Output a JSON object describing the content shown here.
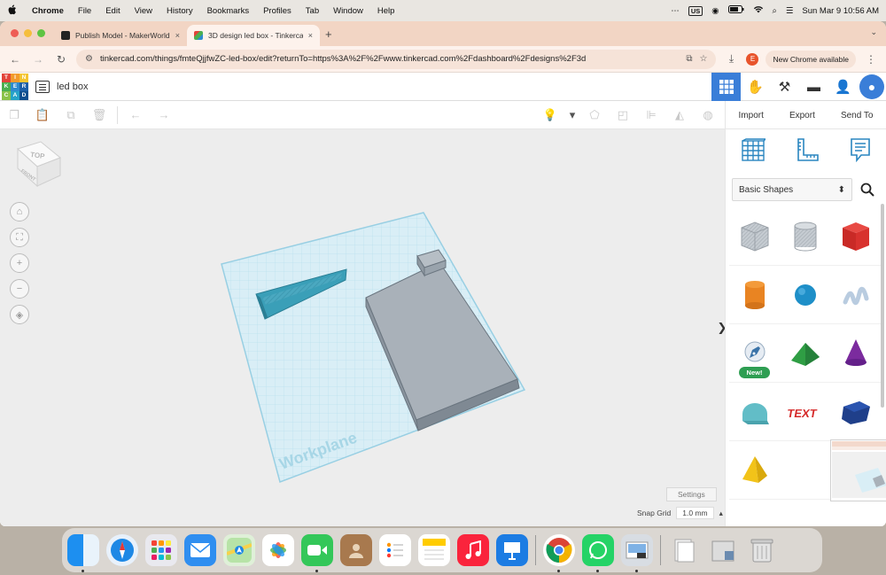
{
  "menubar": {
    "apple": "",
    "items": [
      "Chrome",
      "File",
      "Edit",
      "View",
      "History",
      "Bookmarks",
      "Profiles",
      "Tab",
      "Window",
      "Help"
    ],
    "input_source": "US",
    "datetime": "Sun Mar 9  10:56 AM"
  },
  "browser": {
    "tabs": [
      {
        "title": "Publish Model - MakerWorld",
        "close": "×"
      },
      {
        "title": "3D design led box - Tinkercad",
        "close": "×"
      }
    ],
    "new_tab": "+",
    "tab_menu": "⌄",
    "url": "tinkercad.com/things/fmteQjjfwZC-led-box/edit?returnTo=https%3A%2F%2Fwww.tinkercad.com%2Fdashboard%2Fdesigns%2F3d",
    "profile_initial": "E",
    "update_label": "New Chrome available"
  },
  "app": {
    "logo_letters": [
      "T",
      "I",
      "N",
      "K",
      "E",
      "R",
      "C",
      "A",
      "D"
    ],
    "logo_colors": [
      "#e2443a",
      "#f29a2c",
      "#f4c430",
      "#4caf50",
      "#2e8bcf",
      "#1b5fa8",
      "#8bc34a",
      "#26a3c9",
      "#0d4e8f"
    ],
    "design_name": "led box",
    "toolbar_right": {
      "import": "Import",
      "export": "Export",
      "send_to": "Send To"
    },
    "viewcube": {
      "top": "TOP",
      "front": "FRONT"
    },
    "workplane_label": "Workplane",
    "settings_label": "Settings",
    "snap_grid_label": "Snap Grid",
    "snap_grid_value": "1.0 mm",
    "snap_grid_arrow": "▴",
    "collapse_arrow": "❯",
    "shape_category": "Basic Shapes",
    "new_badge": "New!"
  }
}
